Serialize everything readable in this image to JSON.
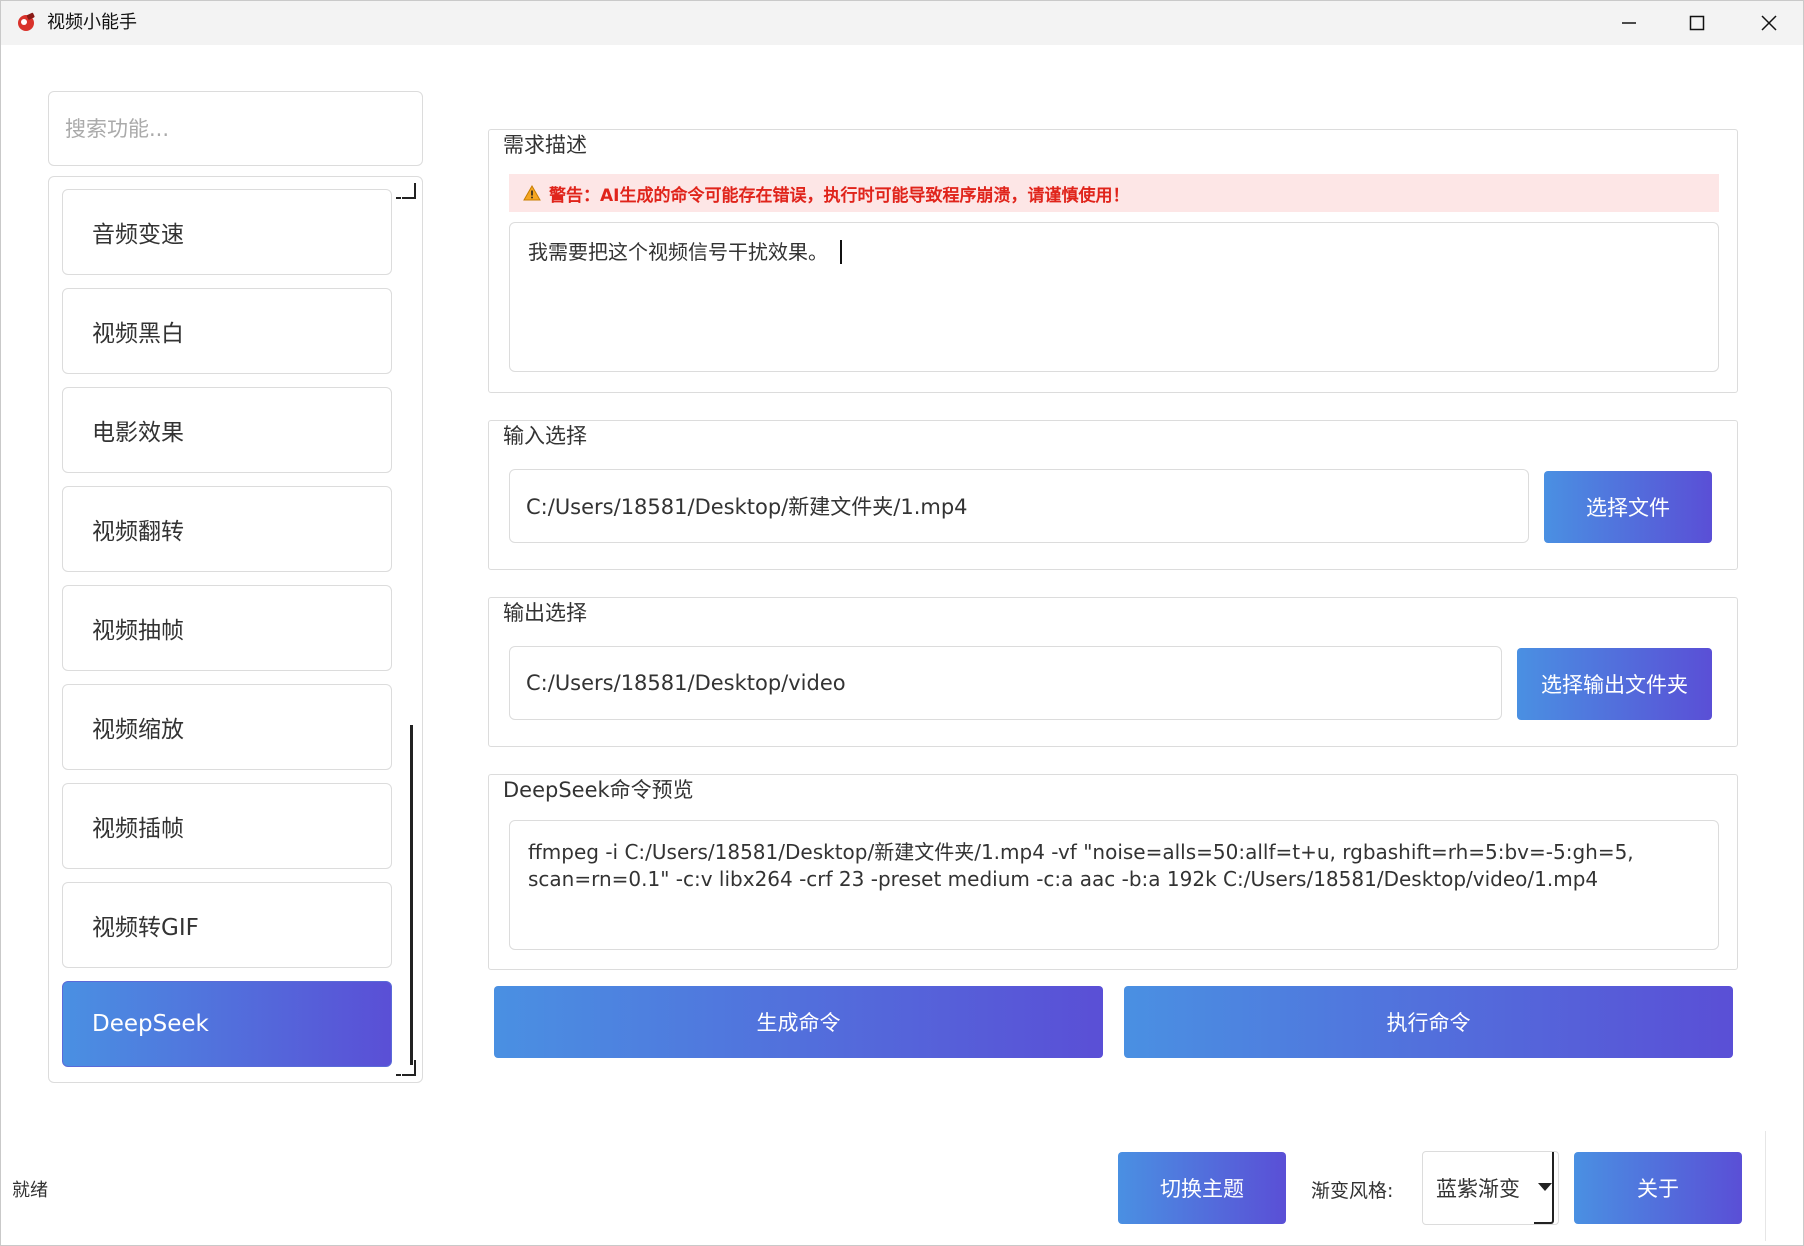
{
  "window": {
    "title": "视频小能手"
  },
  "sidebar": {
    "search_placeholder": "搜索功能...",
    "items": [
      {
        "label": "音频变速"
      },
      {
        "label": "视频黑白"
      },
      {
        "label": "电影效果"
      },
      {
        "label": "视频翻转"
      },
      {
        "label": "视频抽帧"
      },
      {
        "label": "视频缩放"
      },
      {
        "label": "视频插帧"
      },
      {
        "label": "视频转GIF"
      },
      {
        "label": "DeepSeek",
        "active": true
      }
    ]
  },
  "requirement": {
    "title": "需求描述",
    "warning": "警告：AI生成的命令可能存在错误，执行时可能导致程序崩溃，请谨慎使用！",
    "text": "我需要把这个视频信号干扰效果。"
  },
  "input": {
    "title": "输入选择",
    "path": "C:/Users/18581/Desktop/新建文件夹/1.mp4",
    "button": "选择文件"
  },
  "output": {
    "title": "输出选择",
    "path": "C:/Users/18581/Desktop/video",
    "button": "选择输出文件夹"
  },
  "preview": {
    "title": "DeepSeek命令预览",
    "command": "ffmpeg -i C:/Users/18581/Desktop/新建文件夹/1.mp4 -vf \"noise=alls=50:allf=t+u, rgbashift=rh=5:bv=-5:gh=5, scan=rn=0.1\" -c:v libx264 -crf 23 -preset medium -c:a aac -b:a 192k C:/Users/18581/Desktop/video/1.mp4"
  },
  "actions": {
    "generate": "生成命令",
    "execute": "执行命令"
  },
  "footer": {
    "status": "就绪",
    "theme_button": "切换主题",
    "gradient_label": "渐变风格:",
    "gradient_value": "蓝紫渐变",
    "about_button": "关于"
  },
  "colors": {
    "gradient_start": "#4a90e2",
    "gradient_end": "#5a4fd6",
    "warning_bg": "#fde6e6",
    "warning_text": "#e0241b"
  }
}
